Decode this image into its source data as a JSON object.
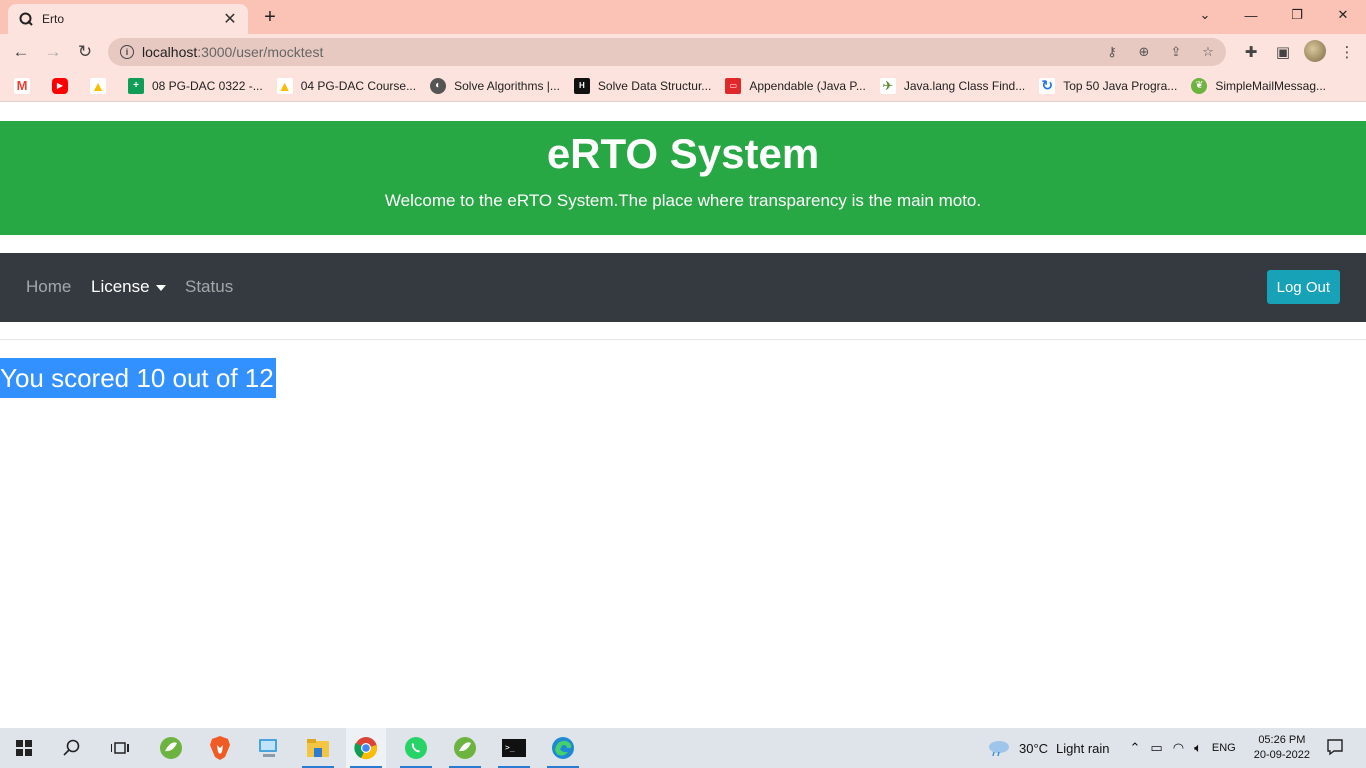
{
  "browser": {
    "tab_title": "Erto",
    "url_host": "localhost",
    "url_path": ":3000/user/mocktest",
    "bookmarks": [
      {
        "label": "08 PG-DAC 0322 -...",
        "icon": "sheets-icon",
        "color": "#0f9d58"
      },
      {
        "label": "04 PG-DAC Course...",
        "icon": "drive-icon",
        "color": "#fbbc04"
      },
      {
        "label": "Solve Algorithms |...",
        "icon": "globe-icon",
        "color": "#555555"
      },
      {
        "label": "Solve Data Structur...",
        "icon": "hackerrank-icon",
        "color": "#111111"
      },
      {
        "label": "Appendable (Java P...",
        "icon": "oracle-icon",
        "color": "#e0282b"
      },
      {
        "label": "Java.lang Class Find...",
        "icon": "bird-icon",
        "color": "#5a8a2e"
      },
      {
        "label": "Top 50 Java Progra...",
        "icon": "refresh-blue-icon",
        "color": "#1a73e8"
      },
      {
        "label": "SimpleMailMessag...",
        "icon": "spring-icon",
        "color": "#6db33f"
      }
    ]
  },
  "header": {
    "title": "eRTO System",
    "subtitle": "Welcome to the eRTO System.The place where transparency is the main moto."
  },
  "nav": {
    "home": "Home",
    "license": "License",
    "status": "Status",
    "logout": "Log Out"
  },
  "result": {
    "text": "You scored 10 out of 12"
  },
  "taskbar": {
    "weather_temp": "30°C",
    "weather_text": "Light rain",
    "lang": "ENG",
    "time": "05:26 PM",
    "date": "20-09-2022"
  },
  "colors": {
    "header_bg": "#28a745",
    "navbar_bg": "#343a40",
    "logout_bg": "#17a2b8",
    "selection": "#3390ff"
  }
}
